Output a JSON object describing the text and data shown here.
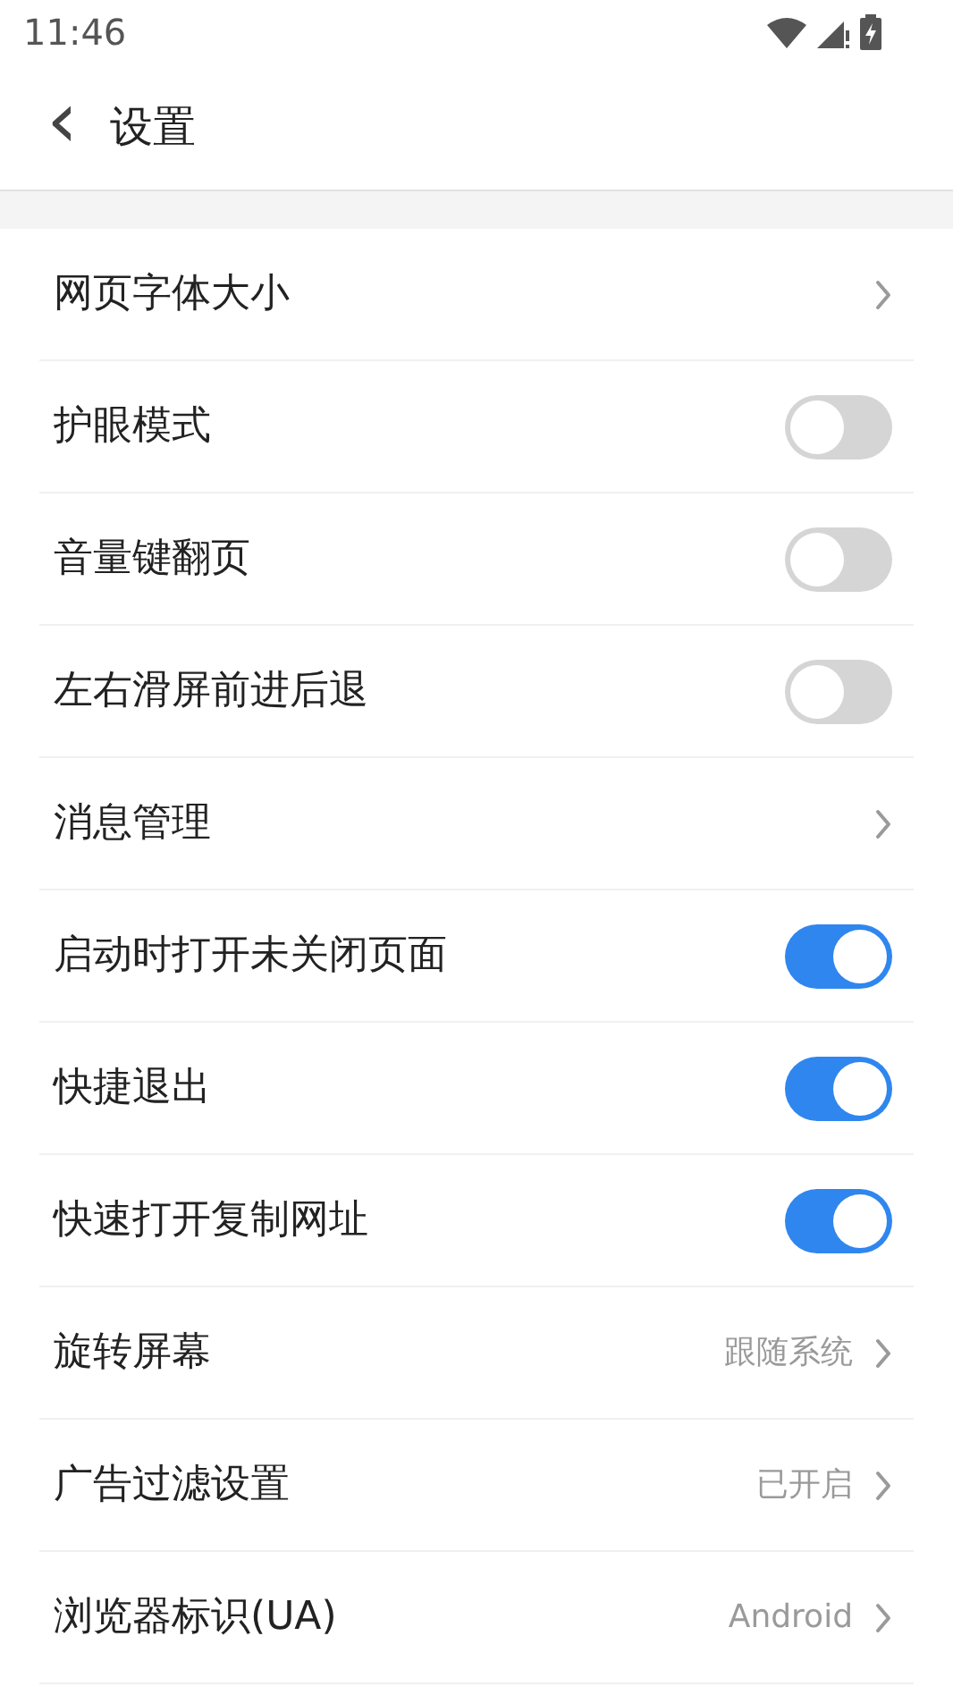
{
  "status_bar": {
    "time": "11:46"
  },
  "header": {
    "back": "‹",
    "title": "设置"
  },
  "rows": [
    {
      "kind": "link",
      "label": "网页字体大小"
    },
    {
      "kind": "toggle",
      "label": "护眼模式",
      "on": false
    },
    {
      "kind": "toggle",
      "label": "音量键翻页",
      "on": false
    },
    {
      "kind": "toggle",
      "label": "左右滑屏前进后退",
      "on": false
    },
    {
      "kind": "link",
      "label": "消息管理"
    },
    {
      "kind": "toggle",
      "label": "启动时打开未关闭页面",
      "on": true
    },
    {
      "kind": "toggle",
      "label": "快捷退出",
      "on": true
    },
    {
      "kind": "toggle",
      "label": "快速打开复制网址",
      "on": true
    },
    {
      "kind": "link",
      "label": "旋转屏幕",
      "value": "跟随系统"
    },
    {
      "kind": "link",
      "label": "广告过滤设置",
      "value": "已开启"
    },
    {
      "kind": "link",
      "label": "浏览器标识(UA)",
      "value": "Android"
    }
  ]
}
